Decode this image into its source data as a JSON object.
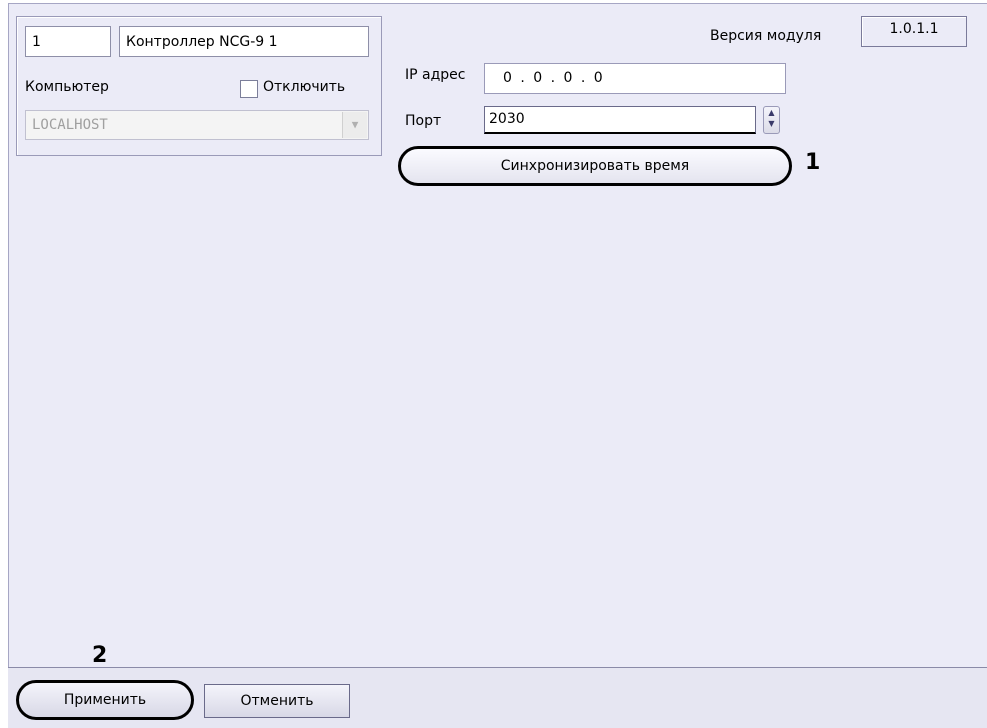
{
  "object": {
    "id_value": "1",
    "name_value": "Контроллер NCG-9 1",
    "computer_label": "Компьютер",
    "disable_label": "Отключить",
    "computer_value": "LOCALHOST"
  },
  "module": {
    "version_label": "Версия модуля",
    "version_value": "1.0.1.1"
  },
  "connection": {
    "ip_label": "IP адрес",
    "ip_value": "0 . 0 . 0 . 0",
    "port_label": "Порт",
    "port_value": "2030"
  },
  "actions": {
    "sync_time_label": "Синхронизировать время",
    "apply_label": "Применить",
    "cancel_label": "Отменить"
  },
  "callouts": {
    "first": "1",
    "second": "2"
  },
  "icons": {
    "combo_arrow": "chevron-down-icon",
    "spinner": "spinner-updown-icon"
  }
}
